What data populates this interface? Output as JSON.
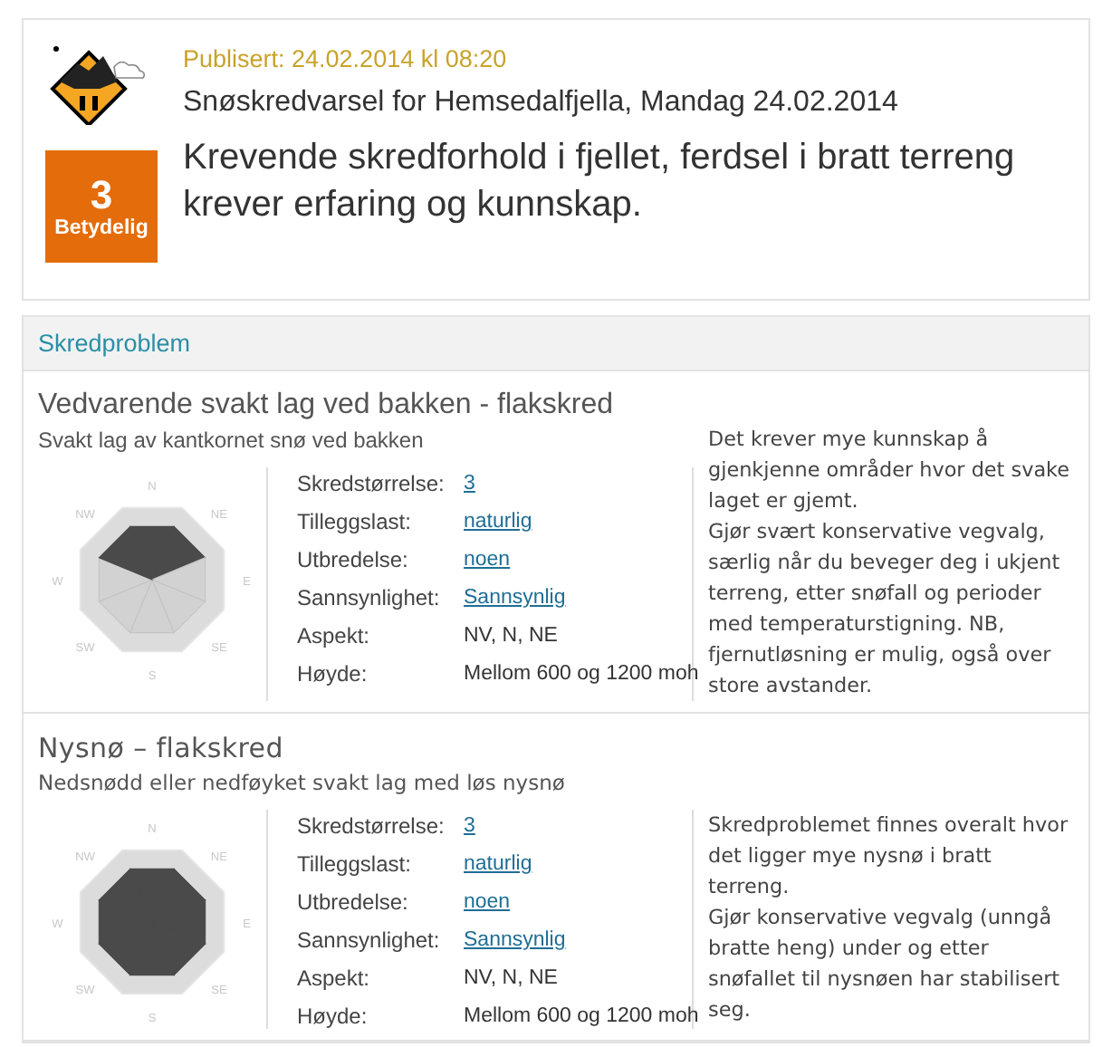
{
  "forecast": {
    "danger_level": "3",
    "danger_name": "Betydelig",
    "published": "Publisert: 24.02.2014 kl 08:20",
    "title": "Snøskredvarsel for Hemsedalfjella, Mandag 24.02.2014",
    "headline": "Krevende skredforhold i fjellet, ferdsel i bratt terreng krever erfaring og kunnskap."
  },
  "section": {
    "title": "Skredproblem"
  },
  "problems": [
    {
      "title": "Vedvarende svakt lag ved bakken - flakskred",
      "subtitle": "Svakt lag av kantkornet snø ved bakken",
      "compass": [
        {
          "label": "N",
          "highlighted": true
        },
        {
          "label": "NE",
          "highlighted": true
        },
        {
          "label": "E",
          "highlighted": false
        },
        {
          "label": "SE",
          "highlighted": false
        },
        {
          "label": "S",
          "highlighted": false
        },
        {
          "label": "SW",
          "highlighted": false
        },
        {
          "label": "W",
          "highlighted": false
        },
        {
          "label": "NW",
          "highlighted": true
        }
      ],
      "facts": [
        {
          "label": "Skredstørrelse:",
          "value": "3",
          "link": true
        },
        {
          "label": "Tilleggslast:",
          "value": "naturlig",
          "link": true
        },
        {
          "label": "Utbredelse:",
          "value": "noen",
          "link": true
        },
        {
          "label": "Sannsynlighet:",
          "value": "Sannsynlig",
          "link": true
        },
        {
          "label": "Aspekt:",
          "value": "NV, N, NE",
          "link": false
        },
        {
          "label": "Høyde:",
          "value": "Mellom 600 og 1200 moh",
          "link": false
        }
      ],
      "advice": [
        "Det krever mye kunnskap å gjenkjenne områder hvor det svake laget er gjemt.",
        "Gjør svært konservative vegvalg, særlig når du beveger deg i ukjent terreng, etter snøfall og perioder med temperaturstigning. NB, fjernutløsning er mulig, også over store avstander."
      ]
    },
    {
      "title": "Nysnø – flakskred",
      "subtitle": "Nedsnødd eller nedføyket svakt lag med løs nysnø",
      "compass": [
        {
          "label": "N",
          "highlighted": true
        },
        {
          "label": "NE",
          "highlighted": true
        },
        {
          "label": "E",
          "highlighted": true
        },
        {
          "label": "SE",
          "highlighted": true
        },
        {
          "label": "S",
          "highlighted": true
        },
        {
          "label": "SW",
          "highlighted": true
        },
        {
          "label": "W",
          "highlighted": true
        },
        {
          "label": "NW",
          "highlighted": true
        }
      ],
      "facts": [
        {
          "label": "Skredstørrelse:",
          "value": "3",
          "link": true
        },
        {
          "label": "Tilleggslast:",
          "value": "naturlig",
          "link": true
        },
        {
          "label": "Utbredelse:",
          "value": "noen",
          "link": true
        },
        {
          "label": "Sannsynlighet:",
          "value": "Sannsynlig",
          "link": true
        },
        {
          "label": "Aspekt:",
          "value": "NV, N, NE",
          "link": false
        },
        {
          "label": "Høyde:",
          "value": "Mellom 600 og 1200 moh",
          "link": false
        }
      ],
      "advice": [
        "Skredproblemet finnes overalt hvor det ligger mye nysnø i bratt terreng.",
        "Gjør konservative vegvalg (unngå bratte heng) under og etter snøfallet til nysnøen har stabilisert seg."
      ]
    }
  ]
}
